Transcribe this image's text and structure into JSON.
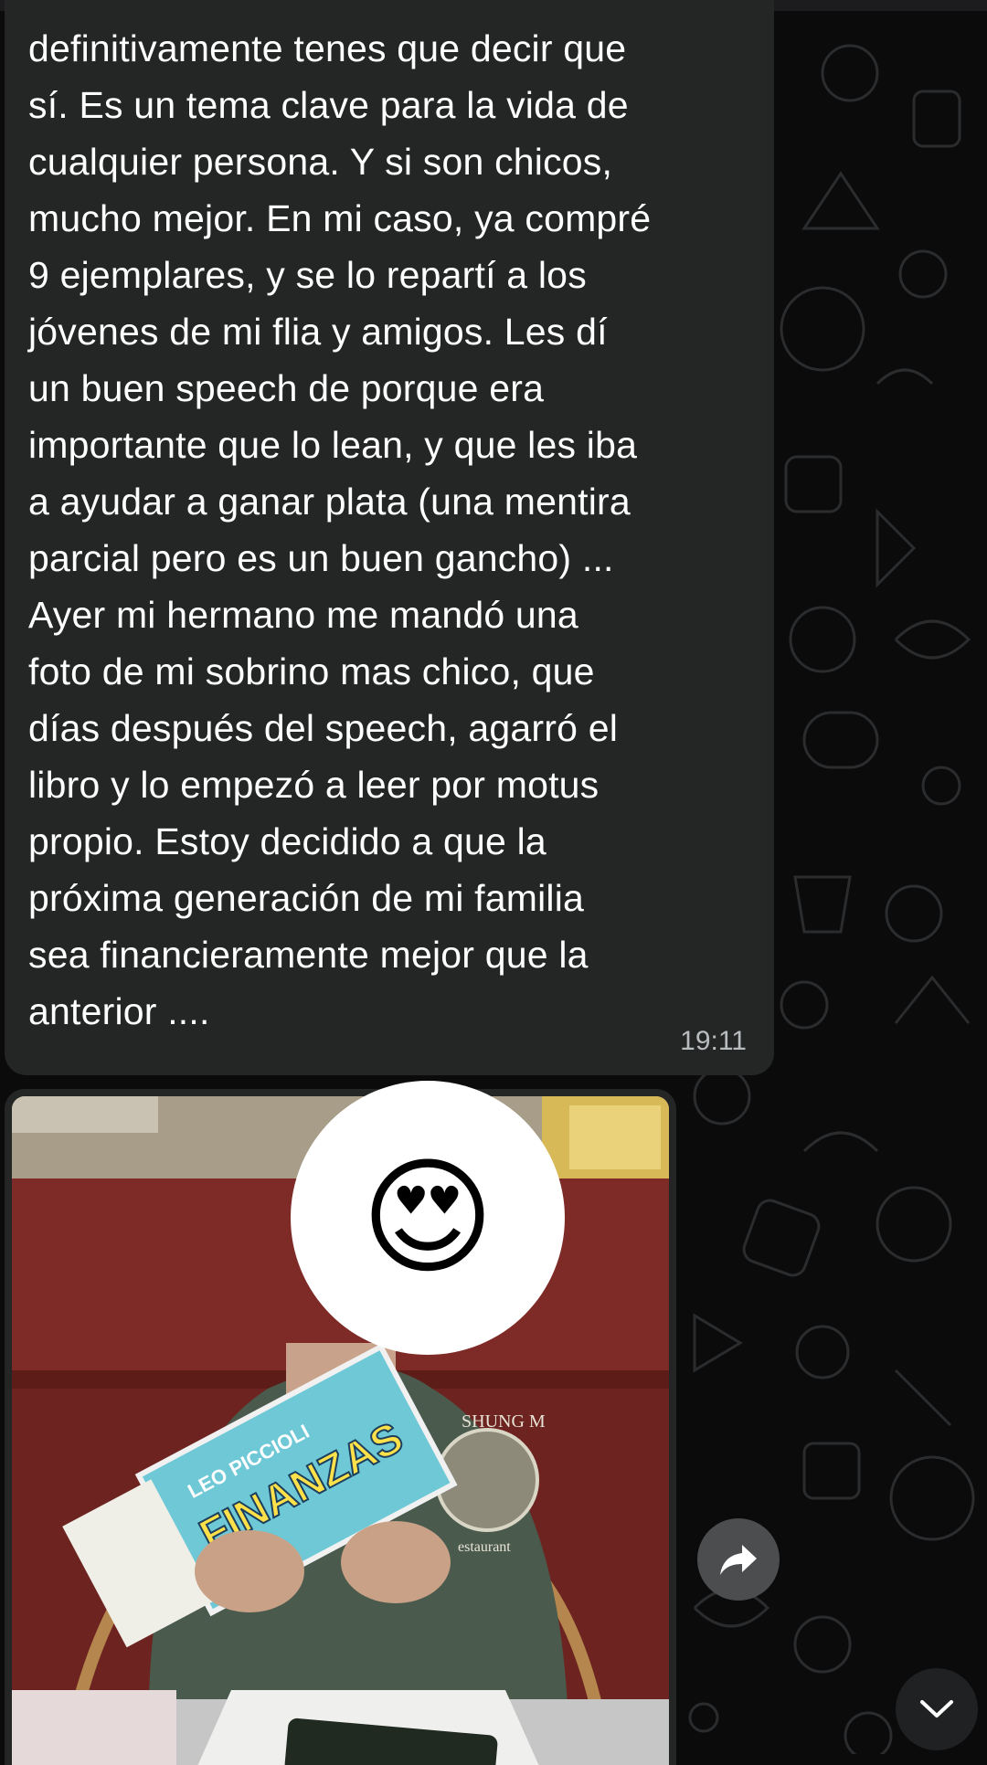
{
  "message": {
    "lines": [
      "definitivamente tenes que decir que",
      "sí. Es un tema clave para la vida de",
      "cualquier persona. Y si son chicos,",
      "mucho mejor. En mi caso, ya compré",
      "9 ejemplares, y se lo repartí a los",
      "jóvenes de mi flia y amigos. Les dí",
      "un buen speech de porque era",
      "importante que lo lean, y que les iba",
      "a ayudar a ganar plata (una mentira",
      "parcial pero es un buen gancho) ...",
      "Ayer mi hermano me mandó una",
      "foto de mi sobrino mas chico, que",
      "días después del speech, agarró el",
      "libro y lo empezó a leer por motus",
      "propio. Estoy decidido a que la",
      "próxima generación de mi familia",
      "sea financieramente mejor que la",
      "anterior ...."
    ],
    "time": "19:11"
  },
  "photo": {
    "book_author": "LEO PICCIOLI",
    "book_title": "FINANZAS",
    "shirt_text": "SHUNG M",
    "shirt_subtext": "estaurant",
    "sticker": "😍"
  },
  "icons": {
    "share": "share-arrow-icon",
    "scroll": "chevron-down-icon"
  },
  "colors": {
    "background": "#0b0b0c",
    "bubble": "#242626",
    "timestamp": "#b9bcbf"
  }
}
